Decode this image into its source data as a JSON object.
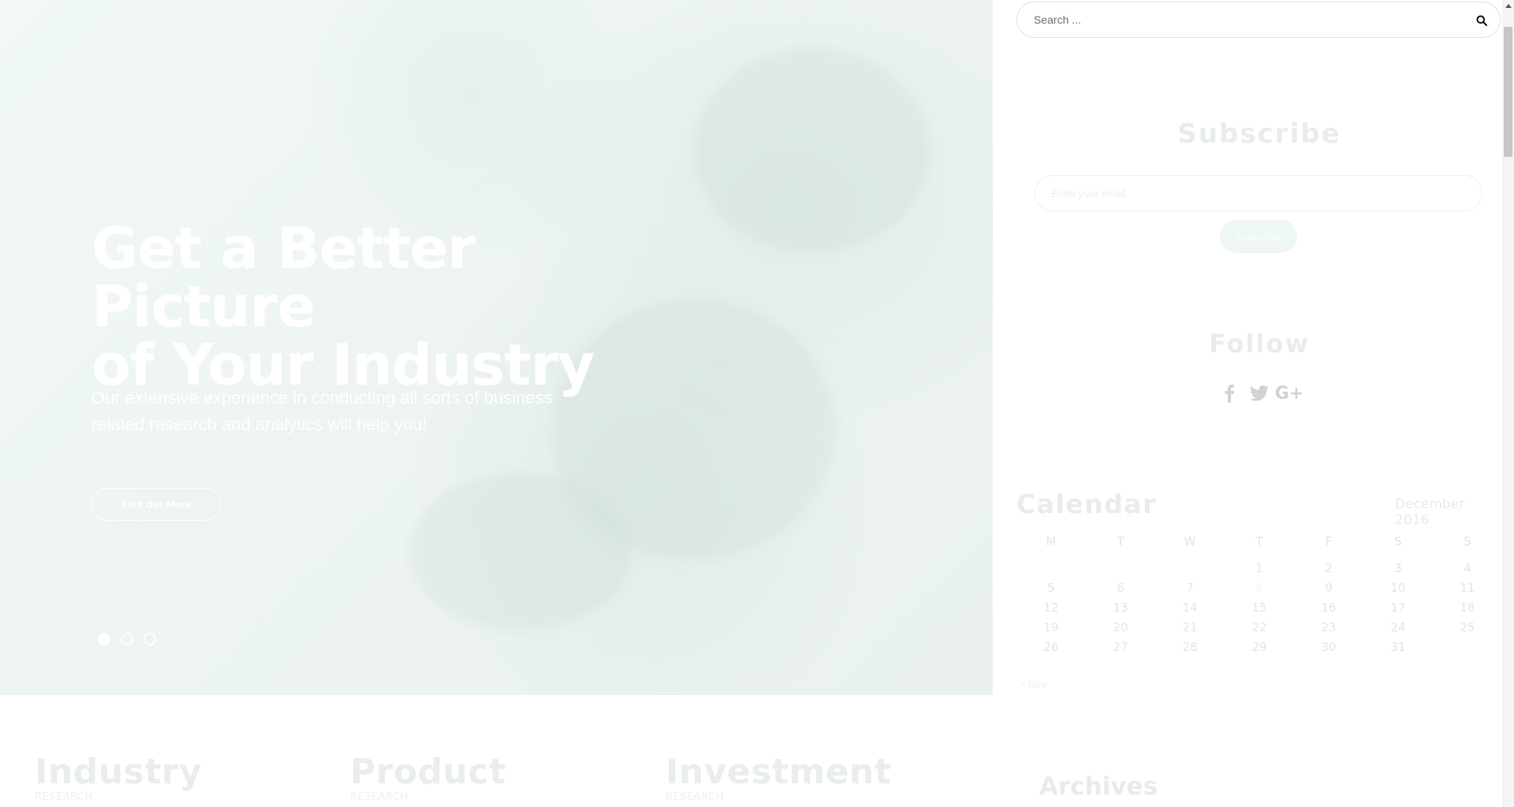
{
  "hero": {
    "title_line1": "Get a Better Picture",
    "title_line2": "of Your Industry",
    "subtitle_line1": "Our extensive experience in conducting all sorts of business",
    "subtitle_line2": "related research and analytics will help you!",
    "cta_label": "Find Out More",
    "slides": 3,
    "active_slide": 1
  },
  "search": {
    "placeholder": "Search ..."
  },
  "subscribe": {
    "title": "Subscribe",
    "email_placeholder": "Enter your email",
    "button_label": "Subscribe"
  },
  "follow": {
    "title": "Follow",
    "icons": [
      "facebook-icon",
      "twitter-icon",
      "google-plus-icon"
    ],
    "google_plus_glyph": "G+"
  },
  "calendar": {
    "title": "Calendar",
    "month": "December 2016",
    "weekdays": [
      "M",
      "T",
      "W",
      "T",
      "F",
      "S",
      "S"
    ],
    "weeks": [
      [
        "",
        "",
        "",
        "1",
        "2",
        "3",
        "4"
      ],
      [
        "5",
        "6",
        "7",
        "8",
        "9",
        "10",
        "11"
      ],
      [
        "12",
        "13",
        "14",
        "15",
        "16",
        "17",
        "18"
      ],
      [
        "19",
        "20",
        "21",
        "22",
        "23",
        "24",
        "25"
      ],
      [
        "26",
        "27",
        "28",
        "29",
        "30",
        "31",
        ""
      ]
    ],
    "prev_link": "« Nov"
  },
  "archives": {
    "title": "Archives"
  },
  "features": [
    {
      "title": "Industry",
      "subtitle": "RESEARCH"
    },
    {
      "title": "Product",
      "subtitle": "RESEARCH"
    },
    {
      "title": "Investment",
      "subtitle": "RESEARCH"
    }
  ],
  "colors": {
    "hero_tint": "#edf4f2",
    "subscribe_button": "#eef7f4",
    "search_border": "#dfe3e2"
  }
}
